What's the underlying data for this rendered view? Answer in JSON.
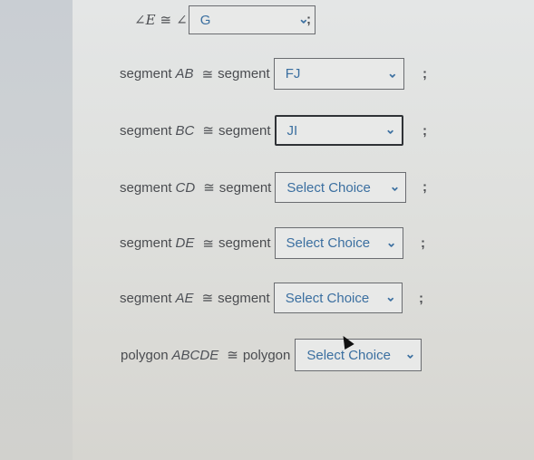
{
  "rows": [
    {
      "prefix": "∠E",
      "symbol": "≅",
      "suffix": "∠",
      "value": "G",
      "type": "angle"
    },
    {
      "prefix": "segment",
      "var": "AB",
      "symbol": "≅",
      "suffix": "segment",
      "value": "FJ"
    },
    {
      "prefix": "segment",
      "var": "BC",
      "symbol": "≅",
      "suffix": "segment",
      "value": "JI"
    },
    {
      "prefix": "segment",
      "var": "CD",
      "symbol": "≅",
      "suffix": "segment",
      "value": "Select Choice"
    },
    {
      "prefix": "segment",
      "var": "DE",
      "symbol": "≅",
      "suffix": "segment",
      "value": "Select Choice"
    },
    {
      "prefix": "segment",
      "var": "AE",
      "symbol": "≅",
      "suffix": "segment",
      "value": "Select Choice"
    },
    {
      "prefix": "polygon",
      "var": "ABCDE",
      "symbol": "≅",
      "suffix": "polygon",
      "value": "Select Choice"
    }
  ],
  "terminator": ";",
  "icons": {
    "dropdown": "chevron-down-icon",
    "cursor": "mouse-pointer-icon"
  },
  "colors": {
    "choice_text": "#3b6fa0",
    "label_text": "#4a4c50"
  }
}
